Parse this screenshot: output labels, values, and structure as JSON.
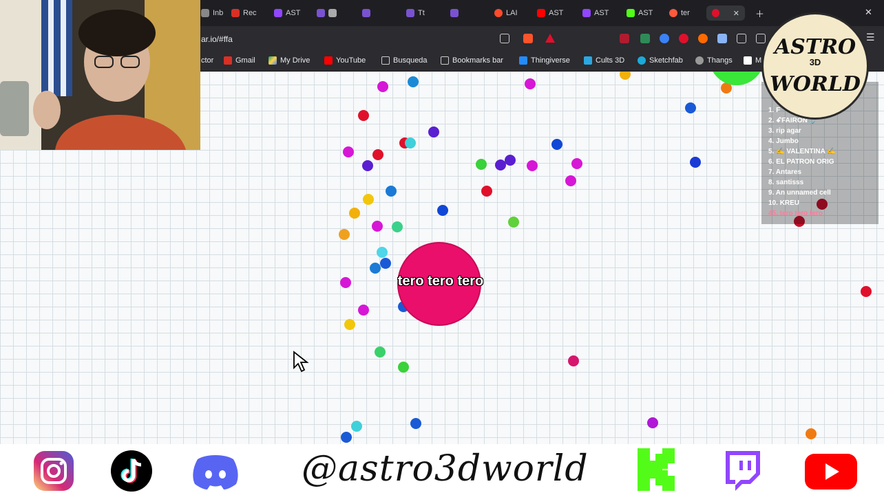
{
  "browser": {
    "tabs": [
      {
        "label": "Inb",
        "icon": "inbox-icon"
      },
      {
        "label": "Rec",
        "icon": "gmail-icon"
      },
      {
        "label": "AST",
        "icon": "twitch-icon"
      },
      {
        "label": "",
        "icon": "hexagon-icon"
      },
      {
        "label": "",
        "icon": "crown-icon"
      },
      {
        "label": "Tt",
        "icon": "tiktok-icon"
      },
      {
        "label": "",
        "icon": "crown-icon"
      },
      {
        "label": "LAI",
        "icon": "opera-icon"
      },
      {
        "label": "AST",
        "icon": "youtube-icon"
      },
      {
        "label": "AST",
        "icon": "twitch-icon"
      },
      {
        "label": "AST",
        "icon": "kick-icon"
      },
      {
        "label": "ter",
        "icon": "agar-icon"
      }
    ],
    "active_tab_label": "",
    "url": "ar.io/#ffa",
    "bookmarks": [
      {
        "label": "ctor",
        "icon": "folder-icon"
      },
      {
        "label": "Gmail",
        "icon": "gmail-icon"
      },
      {
        "label": "My Drive",
        "icon": "drive-icon"
      },
      {
        "label": "YouTube",
        "icon": "youtube-icon"
      },
      {
        "label": "Busqueda",
        "icon": "folder-icon"
      },
      {
        "label": "Bookmarks bar",
        "icon": "folder-icon"
      },
      {
        "label": "Thingiverse",
        "icon": "thingiverse-icon"
      },
      {
        "label": "Cults 3D",
        "icon": "cults-icon"
      },
      {
        "label": "Sketchfab",
        "icon": "sketchfab-icon"
      },
      {
        "label": "Thangs",
        "icon": "thangs-icon"
      },
      {
        "label": "M",
        "icon": "w-icon"
      }
    ]
  },
  "game": {
    "player_name": "tero tero tero",
    "player_color": "#ea0f6a",
    "leaderboard": [
      {
        "rank": "1.",
        "name": "F"
      },
      {
        "rank": "2.",
        "name": "ꗃFAIRON⚓"
      },
      {
        "rank": "3.",
        "name": "rip agar"
      },
      {
        "rank": "4.",
        "name": "Jumbo"
      },
      {
        "rank": "5.",
        "name": "✍ VALENTINA ✍"
      },
      {
        "rank": "6.",
        "name": "EL PATRON ORIG"
      },
      {
        "rank": "7.",
        "name": "Antares"
      },
      {
        "rank": "8.",
        "name": "santisss"
      },
      {
        "rank": "9.",
        "name": "An unnamed cell"
      },
      {
        "rank": "10.",
        "name": "KREU"
      },
      {
        "rank": "45.",
        "name": "tero tero tero"
      }
    ]
  },
  "logo": {
    "line1": "ASTRO",
    "middle": "3D",
    "line2": "WORLD"
  },
  "social": {
    "handle": "@astro3dworld",
    "icons": [
      "instagram-icon",
      "tiktok-icon",
      "discord-icon",
      "kick-icon",
      "twitch-icon",
      "youtube-icon"
    ]
  },
  "colors": {
    "accent_red": "#e0102b",
    "kick_green": "#53fc18",
    "twitch_purple": "#9146ff",
    "discord": "#5865f2"
  }
}
